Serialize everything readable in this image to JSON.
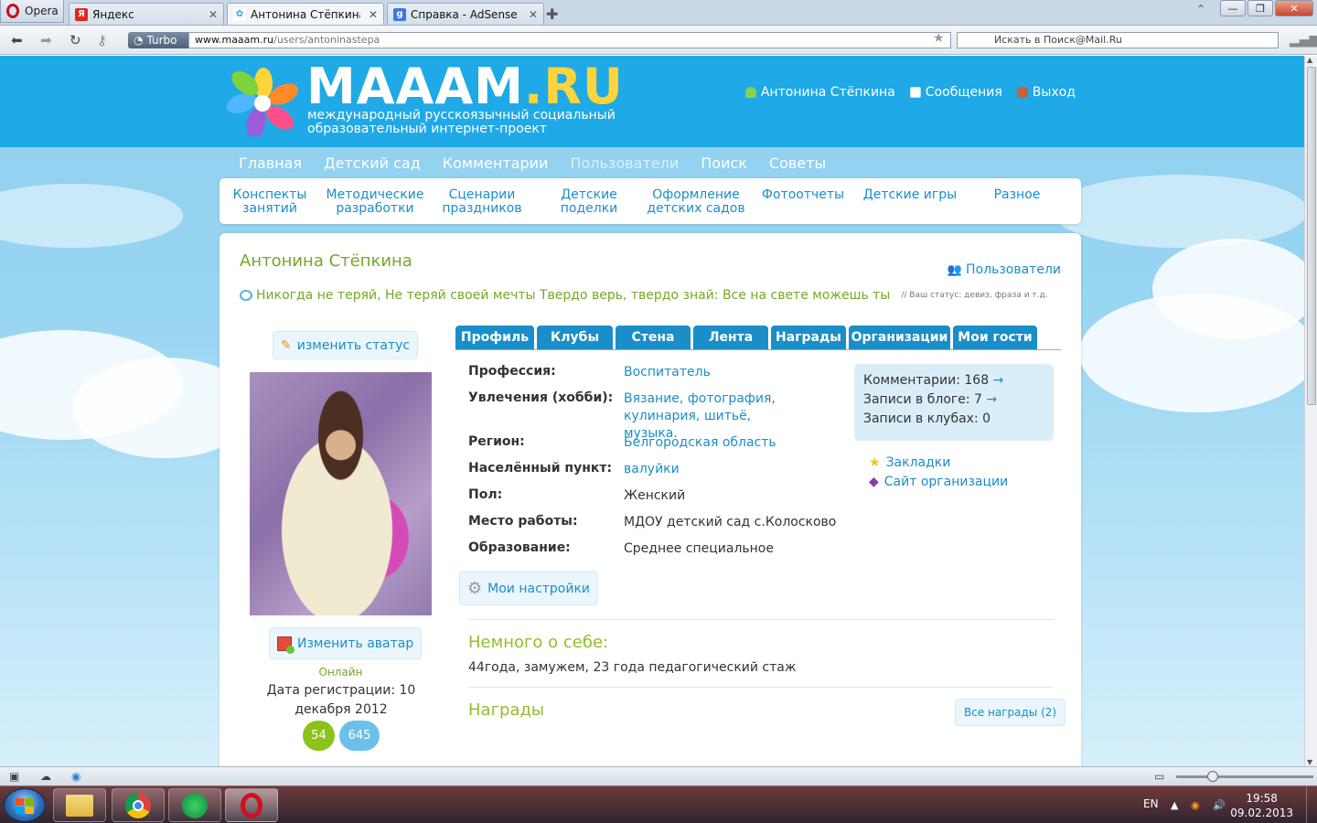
{
  "browser": {
    "app_label": "Opera",
    "tabs": [
      {
        "title": "Яндекс",
        "favicon": "Я",
        "favicon_color": "#e52620"
      },
      {
        "title": "Антонина Стёпкина - ...",
        "favicon": "✿",
        "favicon_color": "#1fa9e6"
      },
      {
        "title": "Справка - AdSense",
        "favicon": "g",
        "favicon_color": "#3b78e7"
      }
    ],
    "turbo_label": "Turbo",
    "url_host": "www.maaam.ru",
    "url_path": "/users/antoninastepa",
    "search_placeholder": "Искать в Поиск@Mail.Ru"
  },
  "site": {
    "logo_main": "MAAAM",
    "logo_tld": ".RU",
    "logo_sub_1": "международный русскоязычный социальный",
    "logo_sub_2": "образовательный интернет-проект",
    "user_name_link": "Антонина Стёпкина",
    "messages_link": "Сообщения",
    "logout_link": "Выход",
    "brand_color": "#1fa9e6"
  },
  "main_nav": [
    "Главная",
    "Детский сад",
    "Комментарии",
    "Пользователи",
    "Поиск",
    "Советы"
  ],
  "categories": [
    [
      "Конспекты",
      "занятий"
    ],
    [
      "Методические",
      "разработки"
    ],
    [
      "Сценарии",
      "праздников"
    ],
    [
      "Детские",
      "поделки"
    ],
    [
      "Оформление",
      "детских садов"
    ],
    [
      "Фотоотчеты",
      ""
    ],
    [
      "Детские игры",
      ""
    ],
    [
      "Разное",
      ""
    ]
  ],
  "profile": {
    "name": "Антонина Стёпкина",
    "users_link": "Пользователи",
    "status_text": "Никогда не теряй, Не теряй своей мечты Твердо верь, твердо знай: Все на свете можешь ты",
    "status_hint": "// Ваш статус: девиз, фраза и т.д.",
    "change_status": "изменить статус",
    "change_avatar": "Изменить аватар",
    "online": "Онлайн",
    "reg_date": "Дата регистрации: 10 декабря 2012",
    "badge_green": "54",
    "badge_blue": "645",
    "tabs": [
      "Профиль",
      "Клубы",
      "Стена",
      "Лента",
      "Награды",
      "Организации",
      "Мои гости"
    ],
    "fields": [
      {
        "label": "Профессия:",
        "value": "Воспитатель",
        "link": true
      },
      {
        "label": "Увлечения (хобби):",
        "value": "Вязание, фотография, кулинария, шитьё, музыка.",
        "link": true
      },
      {
        "label": "Регион:",
        "value": "Белгородская область",
        "link": true
      },
      {
        "label": "Населённый пункт:",
        "value": "валуйки",
        "link": true
      },
      {
        "label": "Пол:",
        "value": "Женский",
        "link": false
      },
      {
        "label": "Место работы:",
        "value": "МДОУ детский сад с.Колосково",
        "link": false
      },
      {
        "label": "Образование:",
        "value": "Среднее специальное",
        "link": false
      }
    ],
    "settings": "Мои настройки",
    "stats": {
      "comments": "Комментарии: 168",
      "blog": "Записи в блоге: 7",
      "clubs": "Записи в клубах: 0",
      "arrow": "→"
    },
    "bookmarks": "Закладки",
    "org_site": "Сайт организации",
    "about_title": "Немного о себе:",
    "about_text": "44года, замужем, 23 года педагогический стаж",
    "awards_title": "Награды",
    "all_awards": "Все награды (2)"
  },
  "taskbar": {
    "lang": "EN",
    "time": "19:58",
    "date": "09.02.2013"
  }
}
